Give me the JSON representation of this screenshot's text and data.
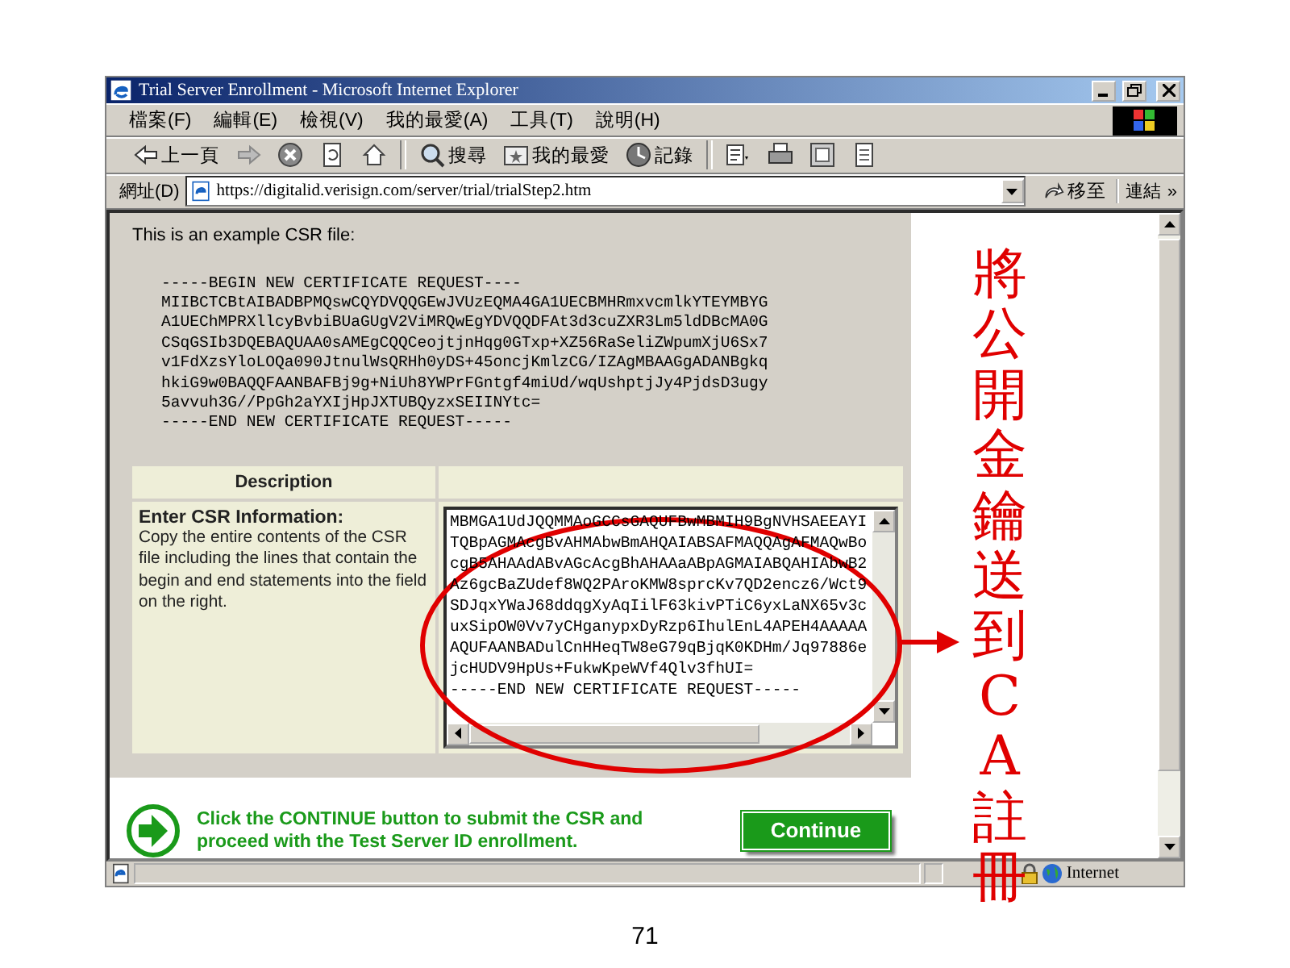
{
  "window": {
    "title": "Trial Server Enrollment - Microsoft Internet Explorer"
  },
  "menu": [
    "檔案(F)",
    "編輯(E)",
    "檢視(V)",
    "我的最愛(A)",
    "工具(T)",
    "說明(H)"
  ],
  "toolbar": [
    {
      "kind": "back",
      "label": "上一頁"
    },
    {
      "kind": "forward"
    },
    {
      "kind": "stop"
    },
    {
      "kind": "refresh"
    },
    {
      "kind": "home"
    },
    {
      "kind": "separator"
    },
    {
      "kind": "search",
      "label": "搜尋"
    },
    {
      "kind": "favorites",
      "label": "我的最愛"
    },
    {
      "kind": "history",
      "label": "記錄"
    },
    {
      "kind": "separator"
    },
    {
      "kind": "mail"
    },
    {
      "kind": "print"
    },
    {
      "kind": "edit"
    },
    {
      "kind": "discuss"
    }
  ],
  "address": {
    "label": "網址(D)",
    "value": "https://digitalid.verisign.com/server/trial/trialStep2.htm",
    "go": "移至",
    "links": "連結",
    "links_more": "»"
  },
  "page": {
    "intro": "This is an example CSR file:",
    "example_csr": [
      "-----BEGIN NEW CERTIFICATE REQUEST----",
      "MIIBCTCBtAIBADBPMQswCQYDVQQGEwJVUzEQMA4GA1UECBMHRmxvcmlkYTEYMBYG",
      "A1UEChMPRXllcyBvbiBUaGUgV2ViMRQwEgYDVQQDFAt3d3cuZXR3Lm5ldDBcMA0G",
      "CSqGSIb3DQEBAQUAA0sAMEgCQQCeojtjnHqg0GTxp+XZ56RaSeliZWpumXjU6Sx7",
      "v1FdXzsYloLOQa090JtnulWsQRHh0yDS+45oncjKmlzCG/IZAgMBAAGgADANBgkq",
      "hkiG9w0BAQQFAANBAFBj9g+NiUh8YWPrFGntgf4miUd/wqUshptjJy4PjdsD3ugy",
      "5avvuh3G//PpGh2aYXIjHpJXTUBQyzxSEIINYtc=",
      "-----END NEW CERTIFICATE REQUEST-----"
    ],
    "table": {
      "header": "Description",
      "label": "Enter CSR Information:",
      "help": "Copy the entire contents of the CSR file including the lines that contain the begin and end statements into the field on the right.",
      "csr_field": [
        "MBMGA1UdJQQMMAoGCCsGAQUFBwMBMIH9BgNVHSAEEAYI",
        "TQBpAGMAcgBvAHMAbwBmAHQAIABSAFMAQQAgAFMAQwBo",
        "cgB5AHAAdABvAGcAcgBhAHAAaABpAGMAIABQAHIAbwB2",
        "Az6gcBaZUdef8WQ2PAroKMW8sprcKv7QD2encz6/Wct9",
        "SDJqxYWaJ68ddqgXyAqIilF63kivPTiC6yxLaNX65v3c",
        "uxSipOW0Vv7yCHganypxDyRzp6IhulEnL4APEH4AAAAA",
        "AQUFAANBADulCnHHeqTW8eG79qBjqK0KDHm/Jq97886e",
        "jcHUDV9HpUs+FukwKpeWVf4Qlv3fhUI=",
        "-----END NEW CERTIFICATE REQUEST-----"
      ]
    },
    "continue_text": "Click the CONTINUE button to submit the CSR and proceed with the Test Server ID enrollment.",
    "continue_button": "Continue"
  },
  "status_bar": {
    "zone": "Internet"
  },
  "annotation": "將公開金鑰送到CA註冊",
  "page_number": "71"
}
